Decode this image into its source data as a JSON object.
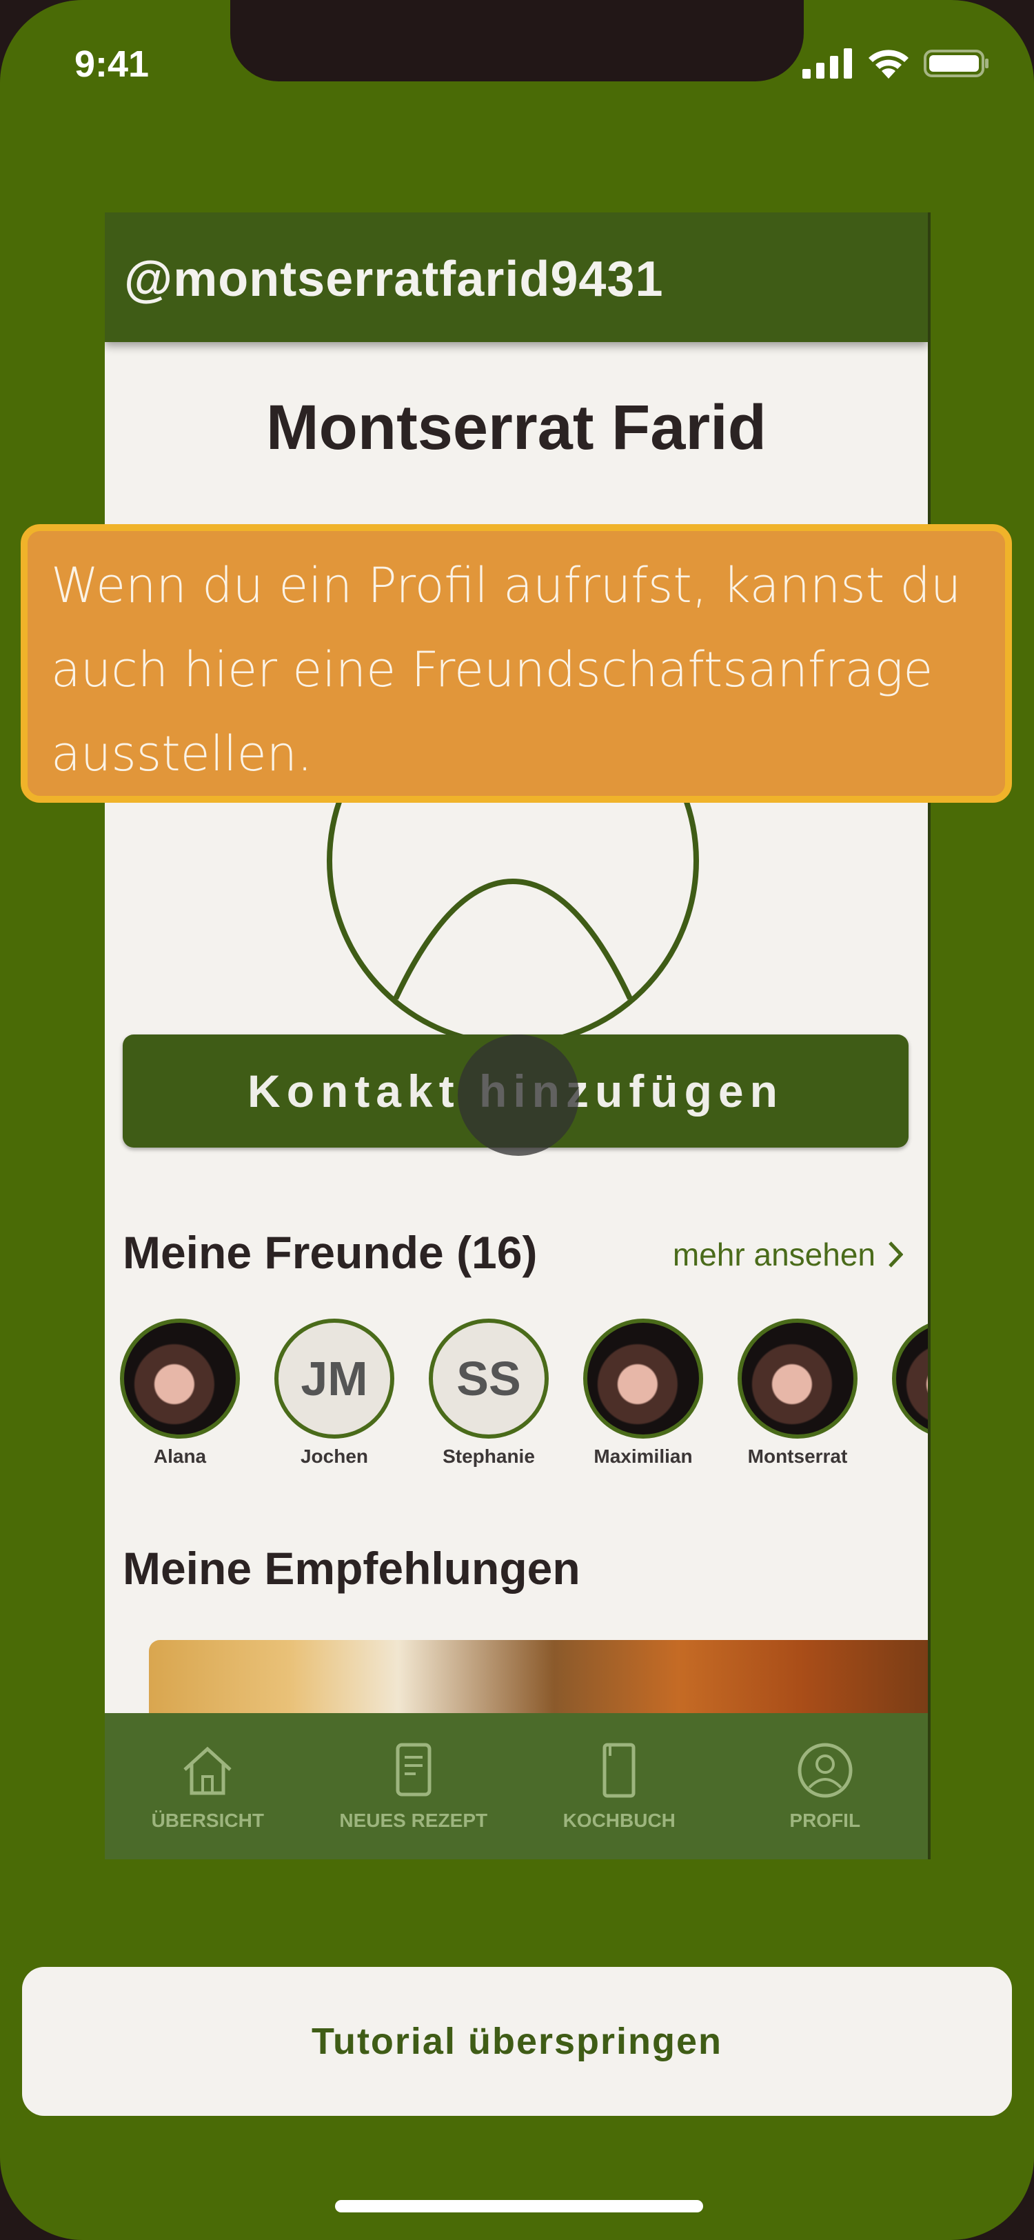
{
  "status_bar": {
    "time": "9:41"
  },
  "app": {
    "handle": "@montserratfarid9431",
    "name": "Montserrat Farid",
    "contact_button": "Kontakt hinzufügen",
    "friends_title": "Meine Freunde (16)",
    "more_link": "mehr ansehen",
    "friends": [
      {
        "name": "Alana",
        "initials": "",
        "photo": true
      },
      {
        "name": "Jochen",
        "initials": "JM",
        "photo": false
      },
      {
        "name": "Stephanie",
        "initials": "SS",
        "photo": false
      },
      {
        "name": "Maximilian",
        "initials": "",
        "photo": true
      },
      {
        "name": "Montserrat",
        "initials": "",
        "photo": true
      }
    ],
    "recommendations_title": "Meine Empfehlungen",
    "nav": [
      {
        "label": "ÜBERSICHT",
        "icon": "house-icon"
      },
      {
        "label": "NEUES REZEPT",
        "icon": "recipe-note-icon"
      },
      {
        "label": "KOCHBUCH",
        "icon": "cookbook-icon"
      },
      {
        "label": "PROFIL",
        "icon": "profile-icon"
      }
    ]
  },
  "tooltip": {
    "text": "Wenn du ein Profil aufrufst, kannst du auch hier eine Freundschaftsanfrage ausstellen."
  },
  "skip_button": "Tutorial überspringen",
  "colors": {
    "background": "#4a6b06",
    "header": "#3f5c16",
    "tooltip": "#e1963a",
    "tooltip_border": "#f0b32a"
  }
}
